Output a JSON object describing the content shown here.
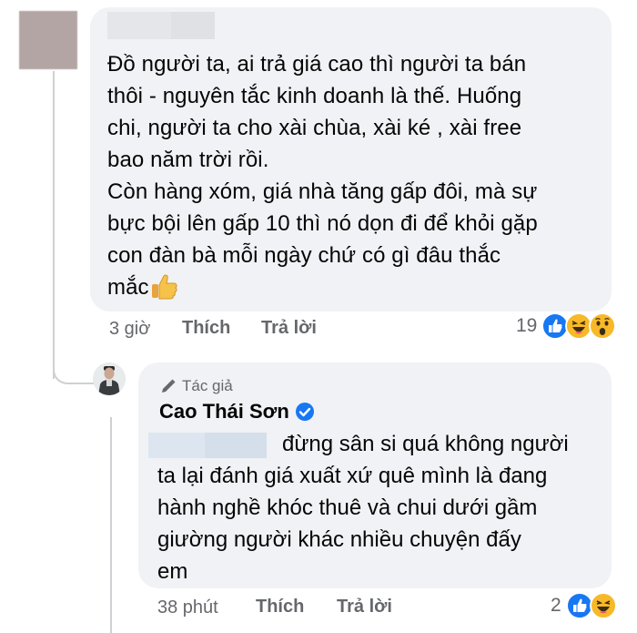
{
  "comment": {
    "text_lines": [
      "Đồ người ta, ai trả giá cao thì người ta bán",
      "thôi - nguyên tắc kinh doanh là thế. Huống",
      "chi, người ta cho xài chùa, xài ké , xài free",
      "bao năm trời rồi.",
      "Còn hàng xóm, giá nhà tăng gấp đôi, mà sự",
      "bực bội lên gấp 10 thì nó dọn đi để khỏi gặp",
      "con đàn bà mỗi ngày chứ có gì đâu thắc",
      "mắc"
    ],
    "emoji": "thumbs-up-icon",
    "time": "3 giờ",
    "like_label": "Thích",
    "reply_label": "Trả lời",
    "reaction_count": "19",
    "reactions": [
      "like",
      "haha",
      "wow"
    ]
  },
  "reply": {
    "author_badge": "Tác giả",
    "author_name": "Cao Thái Sơn",
    "verified": true,
    "text_lines": [
      "đừng sân si quá không người",
      "ta lại đánh giá xuất xứ quê mình là đang",
      "hành nghề khóc thuê và chui dưới gầm",
      "giường người khác nhiều chuyện đấy",
      "em"
    ],
    "time": "38 phút",
    "like_label": "Thích",
    "reply_label": "Trả lời",
    "reaction_count": "2",
    "reactions": [
      "like",
      "haha"
    ]
  },
  "colors": {
    "bubble_bg": "#f0f2f5",
    "meta_text": "#65676b",
    "like_blue": "#1877f2",
    "haha_yellow": "#f7b928"
  }
}
